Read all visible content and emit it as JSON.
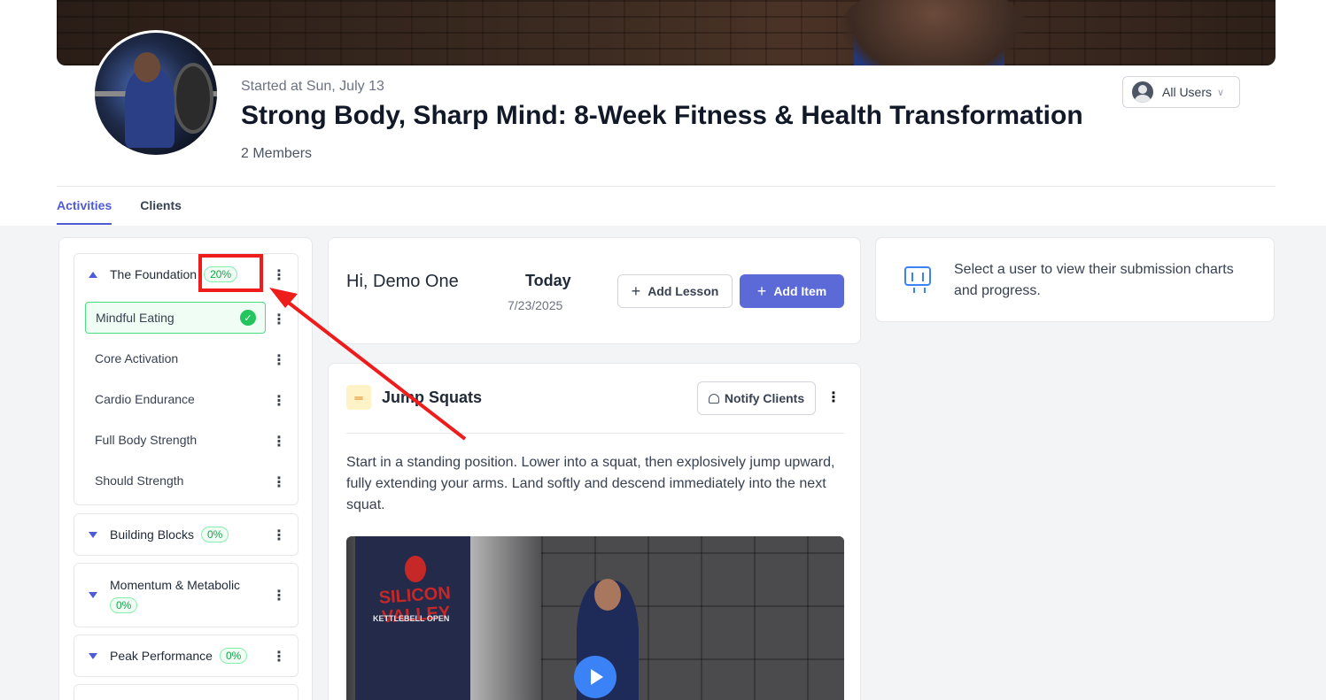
{
  "program": {
    "started": "Started at Sun, July 13",
    "title": "Strong Body, Sharp Mind: 8-Week Fitness & Health Transformation",
    "members": "2 Members"
  },
  "user_filter": {
    "label": "All Users"
  },
  "tabs": [
    {
      "label": "Activities",
      "active": true
    },
    {
      "label": "Clients",
      "active": false
    }
  ],
  "modules": [
    {
      "name": "The Foundation",
      "progress": "20%",
      "expanded": true,
      "lessons": [
        {
          "name": "Mindful Eating",
          "active": true,
          "completed": true
        },
        {
          "name": "Core Activation"
        },
        {
          "name": "Cardio Endurance"
        },
        {
          "name": "Full Body Strength"
        },
        {
          "name": "Should Strength"
        }
      ]
    },
    {
      "name": "Building Blocks",
      "progress": "0%"
    },
    {
      "name": "Momentum & Metabolic",
      "progress": "0%"
    },
    {
      "name": "Peak Performance",
      "progress": "0%"
    }
  ],
  "header_card": {
    "greeting": "Hi, Demo One",
    "today_label": "Today",
    "date": "7/23/2025",
    "add_lesson": "Add Lesson",
    "add_item": "Add Item"
  },
  "lesson_card": {
    "title": "Jump Squats",
    "notify": "Notify Clients",
    "description": "Start in a standing position. Lower into a squat, then explosively jump upward, fully extending your arms. Land softly and descend immediately into the next squat.",
    "video_banner_title": "SILICON VALLEY",
    "video_banner_sub": "KETTLEBELL OPEN"
  },
  "info_card": {
    "text": "Select a user to view their submission charts and progress."
  },
  "colors": {
    "accent": "#4f5bd5",
    "primary_button": "#5b6ad6",
    "progress_green": "#16a34a",
    "annotation_red": "#ef1c1c"
  },
  "icons": [
    "kebab-icon",
    "check-icon",
    "caret-up-icon",
    "caret-down-icon",
    "plus-icon",
    "bell-icon",
    "dumbbell-icon",
    "monitor-chart-icon",
    "play-icon",
    "user-avatar-icon",
    "chevron-down-icon"
  ]
}
